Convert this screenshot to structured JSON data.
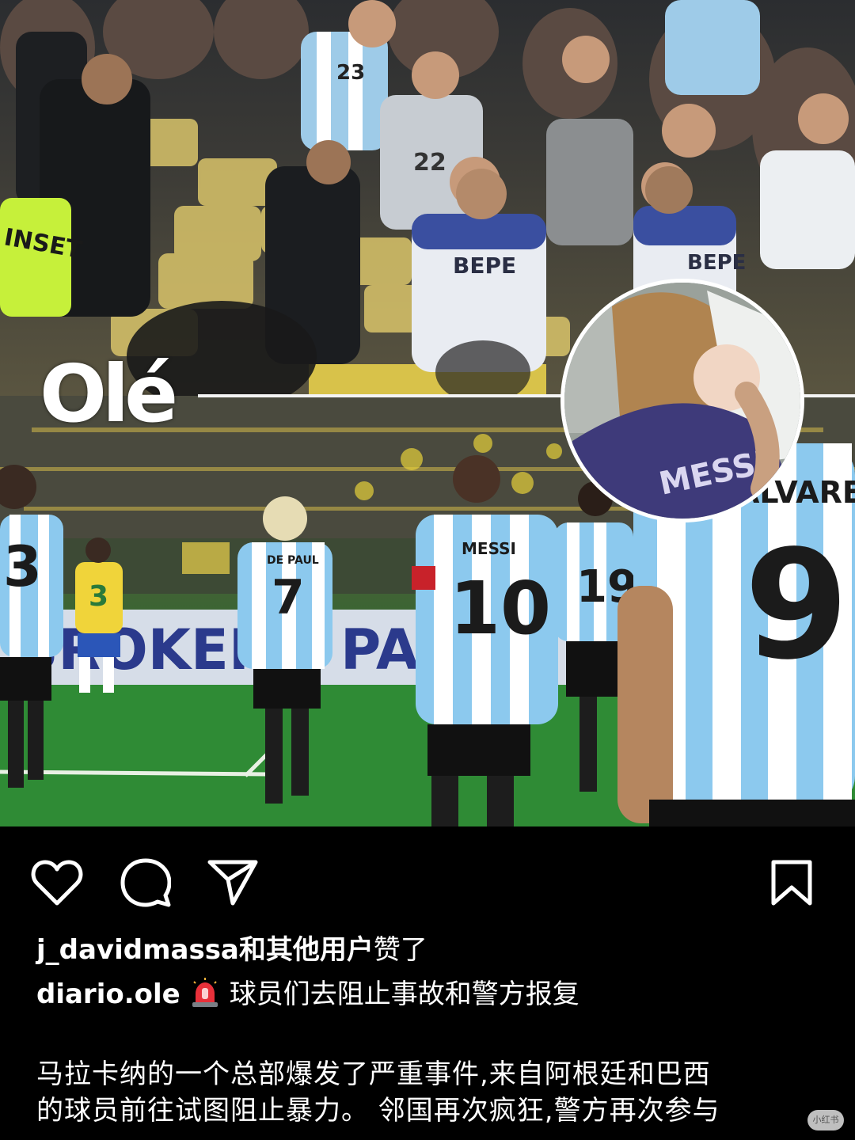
{
  "post": {
    "media": {
      "top_clip_description_icon": "stadium-scuffle-photo",
      "bottom_clip_icon": "players-walking-photo",
      "inset_icon": "child-with-messi-shirt-photo",
      "logo_text": "Olé",
      "jersey_labels": {
        "police_1": "BEPE",
        "police_2": "BEPE",
        "fan_1": "23",
        "fan_2": "22",
        "player_left": "3",
        "player_7_name": "DE PAUL",
        "player_7": "7",
        "player_10_name": "MESSI",
        "player_10": "10",
        "player_19": "19",
        "player_9_name": "ALVAREZ",
        "player_9": "9",
        "player_yellow": "3",
        "inset_shirt": "MESSI",
        "vest": "INSET",
        "board": "BROKER",
        "board2": "PA"
      }
    },
    "actions": {
      "like_icon": "heart-icon",
      "comment_icon": "comment-icon",
      "share_icon": "send-icon",
      "save_icon": "bookmark-icon"
    },
    "likes": {
      "user": "j_davidmassa",
      "rest": "和其他用户",
      "suffix": "赞了"
    },
    "caption": {
      "user": "diario.ole",
      "emoji_icon": "siren-icon",
      "text": "球员们去阻止事故和警方报复"
    },
    "body": {
      "line1": "马拉卡纳的一个总部爆发了严重事件,来自阿根廷和巴西",
      "line2": "的球员前往试图阻止暴力。 邻国再次疯狂,警方再次参与"
    },
    "watermark": "小红书"
  },
  "colors": {
    "argentina_sky": "#7cc4ec",
    "pitch_green": "#2e8a34",
    "police_blue": "#3a4fa0",
    "siren_red": "#e8303a",
    "text_white": "#ffffff",
    "background": "#000000"
  }
}
